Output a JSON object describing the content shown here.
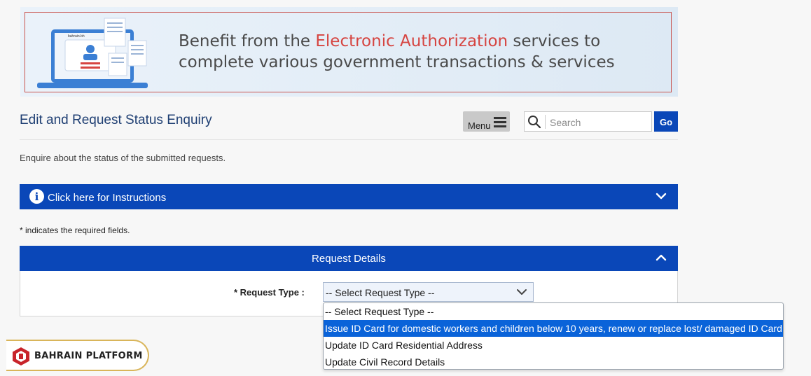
{
  "banner": {
    "line1_pre": "Benefit from the ",
    "line1_highlight": "Electronic Authorization",
    "line1_post": " services to",
    "line2": "complete various government transactions & services",
    "screen_brand": "bahrain.bh",
    "highlight_color": "#d64541"
  },
  "header": {
    "title": "Edit and Request Status Enquiry",
    "menu_label": "Menu",
    "search_placeholder": "Search",
    "go_label": "Go"
  },
  "description": "Enquire about the status of the submitted requests.",
  "instructions": {
    "label": "Click here for Instructions"
  },
  "required_note": "* indicates the required fields.",
  "request_details": {
    "title": "Request Details",
    "request_type_label": "* Request Type :",
    "selected_value": "-- Select Request Type --",
    "options": [
      "-- Select Request Type --",
      "Issue ID Card for domestic workers and children below 10 years, renew or replace lost/ damaged ID Card",
      "Update ID Card Residential Address",
      "Update Civil Record Details"
    ],
    "highlighted_option_index": 1
  },
  "platform_badge": {
    "label": "BAHRAIN PLATFORM"
  },
  "colors": {
    "primary": "#0a47b8",
    "highlight": "#0a63d9",
    "badge_border": "#d9b55a"
  }
}
